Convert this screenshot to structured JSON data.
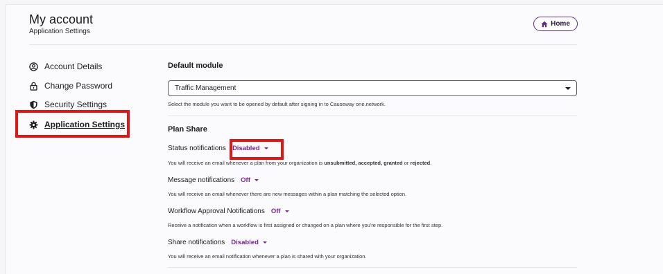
{
  "header": {
    "title": "My account",
    "subtitle": "Application Settings",
    "home_label": "Home"
  },
  "sidebar": {
    "items": [
      {
        "label": "Account Details",
        "icon": "user-circle-icon"
      },
      {
        "label": "Change Password",
        "icon": "lock-icon"
      },
      {
        "label": "Security Settings",
        "icon": "shield-icon"
      },
      {
        "label": "Application Settings",
        "icon": "gear-icon",
        "active": true
      }
    ]
  },
  "default_module": {
    "title": "Default module",
    "selected": "Traffic Management",
    "help": "Select the module you want to be opened by default after signing in to Causeway one.network."
  },
  "plan_share": {
    "title": "Plan Share",
    "status": {
      "label": "Status notifications",
      "value": "Disabled",
      "help_prefix": "You will receive an email whenever a plan from your organization is ",
      "help_bold": "unsubmitted, accepted, granted",
      "help_mid": " or ",
      "help_bold2": "rejected",
      "help_suffix": "."
    },
    "message": {
      "label": "Message notifications",
      "value": "Off",
      "help": "You will receive an email whenever there are new messages within a plan matching the selected option."
    },
    "workflow": {
      "label": "Workflow Approval Notifications",
      "value": "Off",
      "help": "Receive a notification when a workflow is first assigned or changed on a plan where you're responsible for the first step."
    },
    "share": {
      "label": "Share notifications",
      "value": "Disabled",
      "help": "You will receive an email notification whenever a plan is shared with your organization."
    }
  },
  "colors": {
    "accent": "#7b2491",
    "highlight": "#e01515",
    "home_border": "#5e2a84"
  }
}
